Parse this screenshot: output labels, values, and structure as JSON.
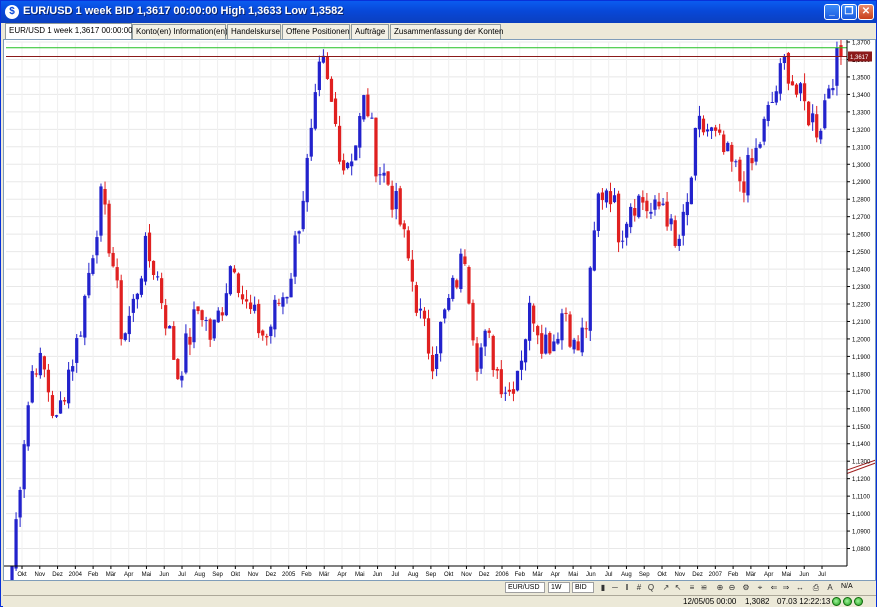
{
  "window": {
    "title": "EUR/USD 1 week BID 1,3617 00:00:00 High 1,3633 Low 1,3582",
    "minimize_label": "_",
    "restore_label": "❐",
    "close_label": "✕"
  },
  "tabs": [
    {
      "label": "EUR/USD 1 week 1,3617 00:00:00",
      "active": true
    },
    {
      "label": "Konto(en) Information(en)"
    },
    {
      "label": "Handelskurse"
    },
    {
      "label": "Offene Positionen"
    },
    {
      "label": "Aufträge"
    },
    {
      "label": "Zusammenfassung der Konten"
    }
  ],
  "chart_data": {
    "type": "candlestick",
    "instrument": "EUR/USD",
    "timeframe": "1W",
    "last_price_label": "1,3617",
    "ylim": [
      1.07,
      1.37
    ],
    "y_ticks": [
      "1,0800",
      "1,0900",
      "1,1000",
      "1,1100",
      "1,1200",
      "1,1300",
      "1,1400",
      "1,1500",
      "1,1600",
      "1,1700",
      "1,1800",
      "1,1900",
      "1,2000",
      "1,2100",
      "1,2200",
      "1,2300",
      "1,2400",
      "1,2500",
      "1,2600",
      "1,2700",
      "1,2800",
      "1,2900",
      "1,3000",
      "1,3100",
      "1,3200",
      "1,3300",
      "1,3400",
      "1,3500",
      "1,3600",
      "1,3700"
    ],
    "x_ticks": [
      "Okt",
      "Nov",
      "Dez",
      "2004",
      "Feb",
      "Mär",
      "Apr",
      "Mai",
      "Jun",
      "Jul",
      "Aug",
      "Sep",
      "Okt",
      "Nov",
      "Dez",
      "2005",
      "Feb",
      "Mär",
      "Apr",
      "Mai",
      "Jun",
      "Jul",
      "Aug",
      "Sep",
      "Okt",
      "Nov",
      "Dez",
      "2006",
      "Feb",
      "Mär",
      "Apr",
      "Mai",
      "Jun",
      "Jul",
      "Aug",
      "Sep",
      "Okt",
      "Nov",
      "Dez",
      "2007",
      "Feb",
      "Mär",
      "Apr",
      "Mai",
      "Jun",
      "Jul"
    ],
    "horizontal_lines": [
      {
        "value": 1.3667,
        "color": "#22C022"
      },
      {
        "value": 1.3617,
        "color": "#8B1A1A"
      }
    ],
    "trend_lines": [
      {
        "x1_week": 254,
        "y1": 1.163,
        "x2_week": 470,
        "y2": 1.347,
        "color": "#A02020"
      },
      {
        "x1_week": 254,
        "y1": 1.163,
        "x2_week": 470,
        "y2": 1.338,
        "color": "#A02020"
      }
    ],
    "close_path": [
      1.07,
      1.14,
      1.19,
      1.18,
      1.15,
      1.18,
      1.2,
      1.24,
      1.28,
      1.25,
      1.2,
      1.22,
      1.25,
      1.24,
      1.21,
      1.18,
      1.2,
      1.22,
      1.2,
      1.22,
      1.25,
      1.22,
      1.21,
      1.2,
      1.22,
      1.23,
      1.27,
      1.31,
      1.36,
      1.33,
      1.3,
      1.31,
      1.34,
      1.3,
      1.29,
      1.27,
      1.24,
      1.21,
      1.19,
      1.21,
      1.23,
      1.25,
      1.19,
      1.2,
      1.18,
      1.17,
      1.19,
      1.22,
      1.2,
      1.2,
      1.22,
      1.19,
      1.21,
      1.28,
      1.29,
      1.26,
      1.28,
      1.28,
      1.27,
      1.28,
      1.25,
      1.27,
      1.32,
      1.32,
      1.31,
      1.3,
      1.29,
      1.3,
      1.32,
      1.34,
      1.36,
      1.34,
      1.33,
      1.32,
      1.35,
      1.362
    ],
    "bull_color": "#2222CC",
    "bear_color": "#E02020"
  },
  "toolbar": {
    "instrument": "EUR/USD",
    "period": "1W",
    "side": "BID",
    "na_label": "N/A"
  },
  "status": {
    "cursor": "12/05/05 00:00",
    "value": "1,3082",
    "datetime": "07.03 12:22:13"
  }
}
